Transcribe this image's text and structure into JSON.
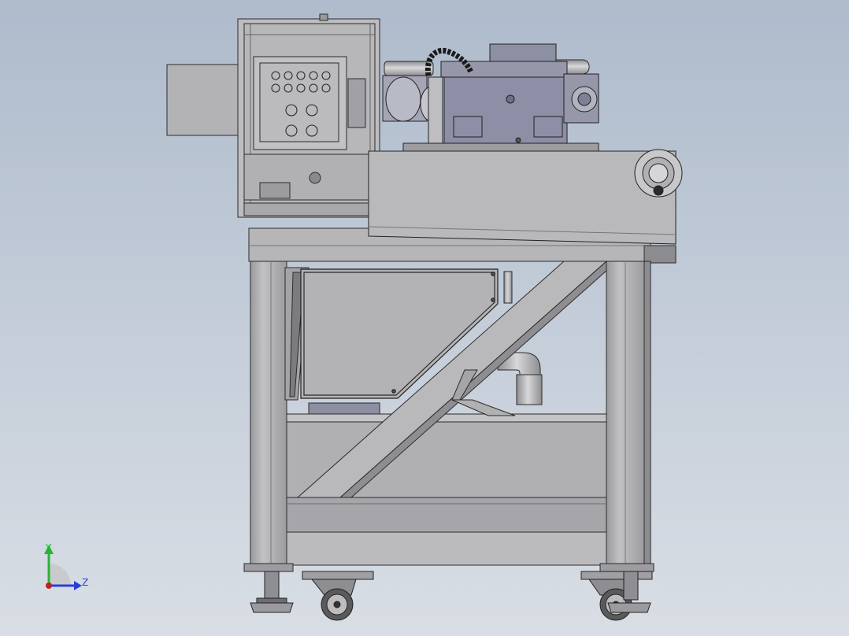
{
  "viewport": {
    "background_top": "#aebbcc",
    "background_bottom": "#d9dee5"
  },
  "model": {
    "colors": {
      "frame_face": "#b4b4b6",
      "frame_shadow": "#8f8f93",
      "frame_edge": "#2b2b2b",
      "panel_gray": "#a9a9ad",
      "motor_blue": "#8d8fa6",
      "motor_dark": "#6d6f86",
      "hose_black": "#1a1a1a",
      "caster_dark": "#555557"
    }
  },
  "triad": {
    "y_label": "Y",
    "z_label": "Z",
    "y_color": "#27b434",
    "z_color": "#2a3fd6",
    "x_color": "#d63a2a",
    "origin_color": "#c11f1f"
  }
}
